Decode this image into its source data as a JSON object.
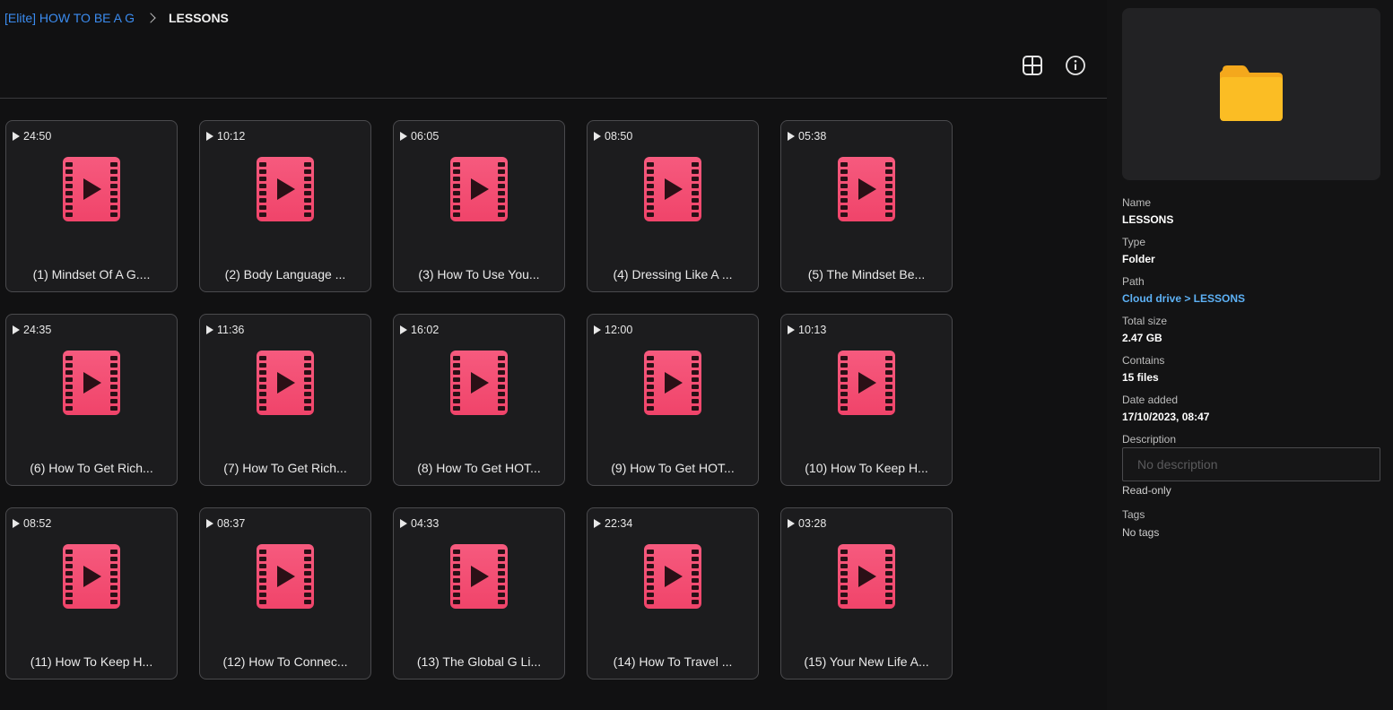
{
  "breadcrumb": {
    "parent": "[Elite] HOW TO BE A G",
    "current": "LESSONS"
  },
  "toolbar": {
    "grid_view_icon": "grid-icon",
    "info_icon": "info-icon"
  },
  "files": [
    {
      "duration": "24:50",
      "name": "(1) Mindset Of A G...."
    },
    {
      "duration": "10:12",
      "name": "(2) Body Language ..."
    },
    {
      "duration": "06:05",
      "name": "(3) How To Use You..."
    },
    {
      "duration": "08:50",
      "name": "(4) Dressing Like A ..."
    },
    {
      "duration": "05:38",
      "name": "(5) The Mindset Be..."
    },
    {
      "duration": "24:35",
      "name": "(6) How To Get Rich..."
    },
    {
      "duration": "11:36",
      "name": "(7) How To Get Rich..."
    },
    {
      "duration": "16:02",
      "name": "(8) How To Get HOT..."
    },
    {
      "duration": "12:00",
      "name": "(9) How To Get HOT..."
    },
    {
      "duration": "10:13",
      "name": "(10) How To Keep H..."
    },
    {
      "duration": "08:52",
      "name": "(11) How To Keep H..."
    },
    {
      "duration": "08:37",
      "name": "(12) How To Connec..."
    },
    {
      "duration": "04:33",
      "name": "(13) The Global G Li..."
    },
    {
      "duration": "22:34",
      "name": "(14) How To Travel ..."
    },
    {
      "duration": "03:28",
      "name": "(15) Your New Life A..."
    }
  ],
  "details": {
    "name_label": "Name",
    "name_value": "LESSONS",
    "type_label": "Type",
    "type_value": "Folder",
    "path_label": "Path",
    "path_value": "Cloud drive > LESSONS",
    "size_label": "Total size",
    "size_value": "2.47 GB",
    "contains_label": "Contains",
    "contains_value": "15 files",
    "date_label": "Date added",
    "date_value": "17/10/2023, 08:47",
    "description_label": "Description",
    "description_placeholder": "No description",
    "readonly_text": "Read-only",
    "tags_label": "Tags",
    "tags_value": "No tags"
  },
  "colors": {
    "accent_link": "#3b8cf0",
    "video_icon": "#f0446a",
    "folder_icon": "#f9b21a"
  }
}
